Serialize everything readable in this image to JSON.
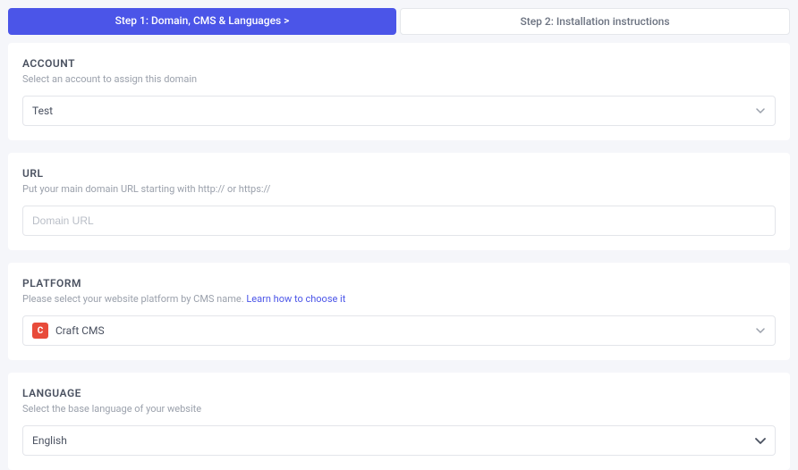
{
  "steps": {
    "step1": "Step 1: Domain, CMS & Languages  >",
    "step2": "Step 2: Installation instructions"
  },
  "account": {
    "title": "ACCOUNT",
    "subtitle": "Select an account to assign this domain",
    "value": "Test"
  },
  "url": {
    "title": "URL",
    "subtitle": "Put your main domain URL starting with http:// or https://",
    "placeholder": "Domain URL",
    "value": ""
  },
  "platform": {
    "title": "PLATFORM",
    "subtitle_prefix": "Please select your website platform by CMS name. ",
    "link_text": "Learn how to choose it",
    "icon_letter": "C",
    "value": "Craft CMS"
  },
  "language": {
    "title": "LANGUAGE",
    "subtitle": "Select the base language of your website",
    "value": "English"
  }
}
